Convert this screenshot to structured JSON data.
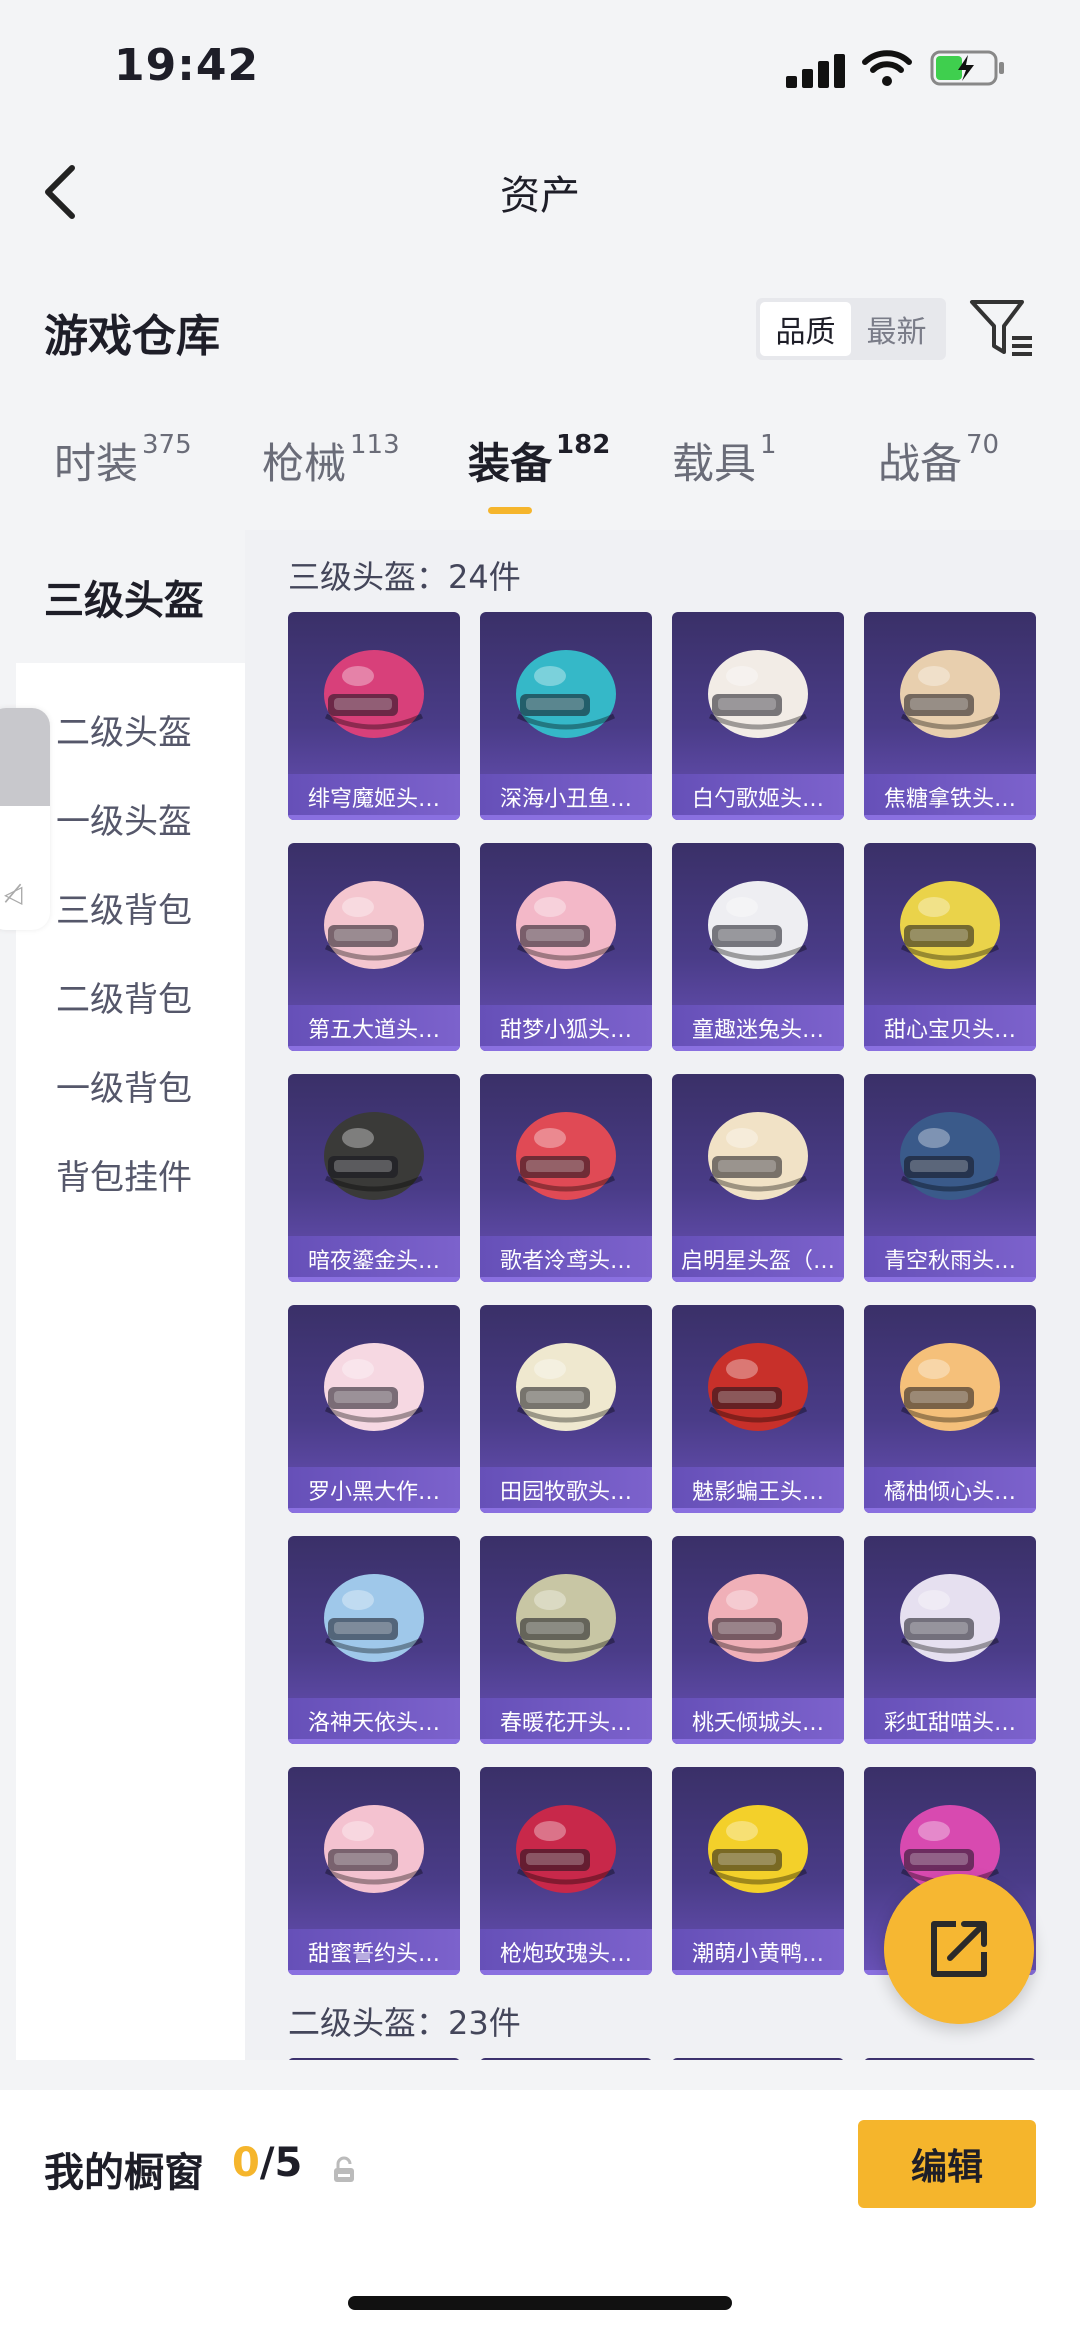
{
  "status_bar": {
    "time": "19:42"
  },
  "header": {
    "title": "资产"
  },
  "section": {
    "title": "游戏仓库",
    "sort_options": [
      "品质",
      "最新"
    ]
  },
  "tabs": [
    {
      "label": "时装",
      "count": "375"
    },
    {
      "label": "枪械",
      "count": "113"
    },
    {
      "label": "装备",
      "count": "182",
      "active": true
    },
    {
      "label": "载具",
      "count": "1"
    },
    {
      "label": "战备",
      "count": "70"
    }
  ],
  "sidebar": {
    "active": "三级头盔",
    "items": [
      "二级头盔",
      "一级头盔",
      "三级背包",
      "二级背包",
      "一级背包",
      "背包挂件"
    ]
  },
  "groups": [
    {
      "title": "三级头盔：24件"
    },
    {
      "title": "二级头盔：23件"
    }
  ],
  "items": [
    {
      "name": "绯穹魔姬头…",
      "color": "#d8407a"
    },
    {
      "name": "深海小丑鱼…",
      "color": "#35b8c8"
    },
    {
      "name": "白勺歌姬头…",
      "color": "#f2ece6"
    },
    {
      "name": "焦糖拿铁头…",
      "color": "#e8cfae"
    },
    {
      "name": "第五大道头…",
      "color": "#f4c6cf"
    },
    {
      "name": "甜梦小狐头…",
      "color": "#f3b8c8"
    },
    {
      "name": "童趣迷兔头…",
      "color": "#eeeef2"
    },
    {
      "name": "甜心宝贝头…",
      "color": "#ead34a"
    },
    {
      "name": "暗夜鎏金头…",
      "color": "#3a3a38"
    },
    {
      "name": "歌者泠鸢头…",
      "color": "#e04a55"
    },
    {
      "name": "启明星头盔（…",
      "color": "#f1e2c6"
    },
    {
      "name": "青空秋雨头…",
      "color": "#3a5a8a"
    },
    {
      "name": "罗小黑大作…",
      "color": "#f6d8e2"
    },
    {
      "name": "田园牧歌头…",
      "color": "#efe8cf"
    },
    {
      "name": "魅影蝙王头…",
      "color": "#c8302a"
    },
    {
      "name": "橘柚倾心头…",
      "color": "#f5c07a"
    },
    {
      "name": "洛神天依头…",
      "color": "#9fc8ea"
    },
    {
      "name": "春暖花开头…",
      "color": "#c8c6a4"
    },
    {
      "name": "桃夭倾城头…",
      "color": "#f0b0b8"
    },
    {
      "name": "彩虹甜喵头…",
      "color": "#e6e0f0"
    },
    {
      "name": "甜蜜誓约头…",
      "color": "#f4c2d0"
    },
    {
      "name": "枪炮玫瑰头…",
      "color": "#c8284a"
    },
    {
      "name": "潮萌小黄鸭…",
      "color": "#f3d02a"
    },
    {
      "name": "",
      "color": "#d84ab0"
    }
  ],
  "footer": {
    "showcase_label": "我的橱窗",
    "showcase_current": "0",
    "showcase_total": "/5",
    "edit_label": "编辑"
  }
}
